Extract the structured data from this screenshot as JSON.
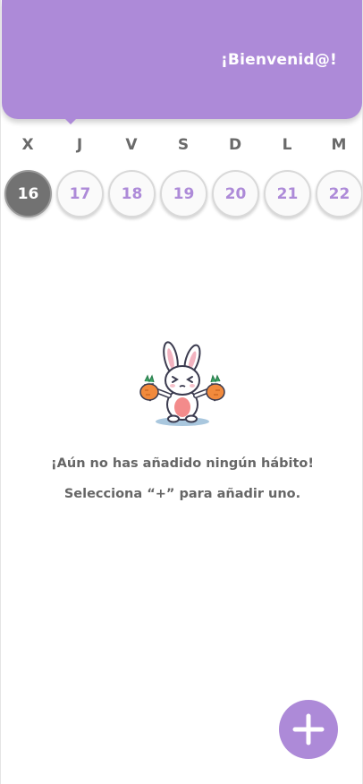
{
  "header": {
    "welcome": "¡Bienvenid@!",
    "background_color": "#ad8ad8"
  },
  "week": {
    "weekdays": [
      "X",
      "J",
      "V",
      "S",
      "D",
      "L",
      "M"
    ],
    "days": [
      "16",
      "17",
      "18",
      "19",
      "20",
      "21",
      "22"
    ],
    "selected_day": "16",
    "selected_color": "#727272",
    "day_text_color": "#ad8ad8"
  },
  "empty_state": {
    "illustration": "bunny-with-carrots-icon",
    "message": "¡Aún no has añadido ningún hábito!",
    "hint": "Selecciona “+” para añadir uno."
  },
  "fab": {
    "icon": "plus-icon",
    "color": "#ad8ad8"
  }
}
